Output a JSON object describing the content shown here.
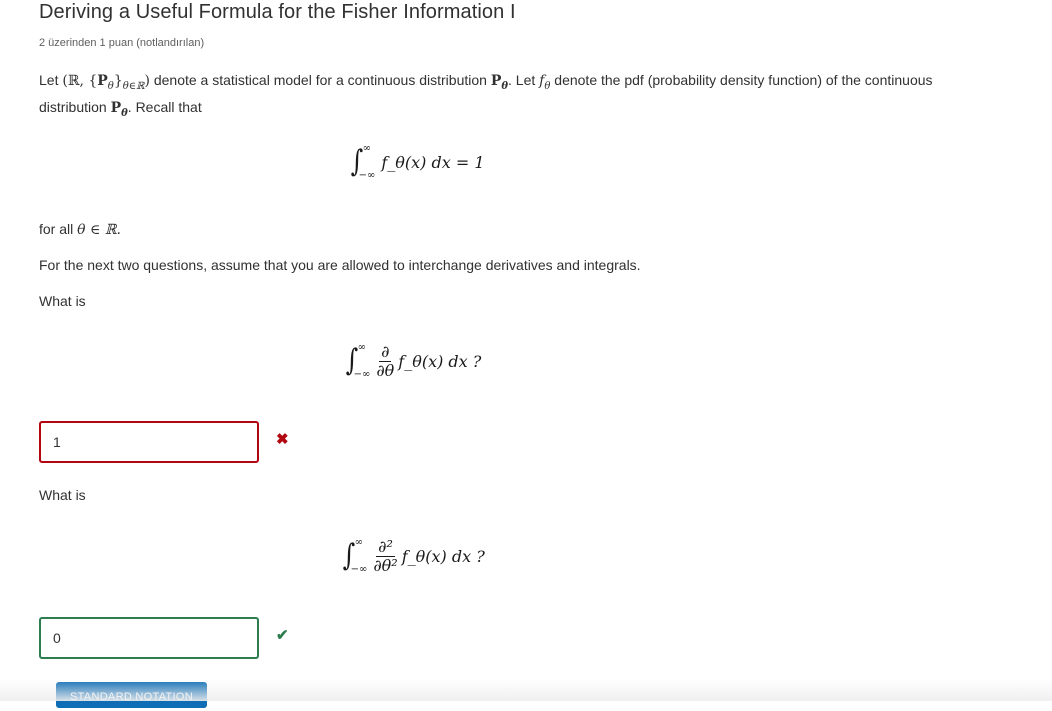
{
  "header": {
    "title": "Deriving a Useful Formula for the Fisher Information I",
    "points": "2 üzerinden 1 puan (notlandırılan)"
  },
  "problem": {
    "intro_let": "Let",
    "model_math": "(ℝ, {P",
    "model_sub": "θ∈ℝ",
    "intro_mid": "denote a statistical model for a continuous distribution",
    "P_theta": "P",
    "theta": "θ",
    "intro_let2": ". Let",
    "f_theta": "f",
    "intro_end": "denote the pdf (probability density function) of the continuous",
    "line2_a": "distribution",
    "line2_b": ". Recall that",
    "recall_formula": "f_θ(x) dx = 1",
    "for_all": "for all",
    "for_all_math": "θ ∈ ℝ.",
    "assumption": "For the next two questions, assume that you are allowed to interchange derivatives and integrals."
  },
  "questions": [
    {
      "prompt": "What is",
      "formula_num": "∂",
      "formula_den": "∂θ",
      "formula_tail": "f_θ(x) dx ?",
      "answer": "1",
      "status": "incorrect",
      "status_icon": "✖"
    },
    {
      "prompt": "What is",
      "formula_num": "∂²",
      "formula_den": "∂θ²",
      "formula_tail": "f_θ(x) dx ?",
      "answer": "0",
      "status": "correct",
      "status_icon": "✔"
    }
  ],
  "integral": {
    "upper": "∞",
    "lower": "−∞",
    "sign": "∫"
  },
  "buttons": {
    "standard_notation": "STANDARD NOTATION"
  },
  "colors": {
    "incorrect": "#b20610",
    "correct": "#2e7d4f",
    "button": "#0f6db5"
  }
}
